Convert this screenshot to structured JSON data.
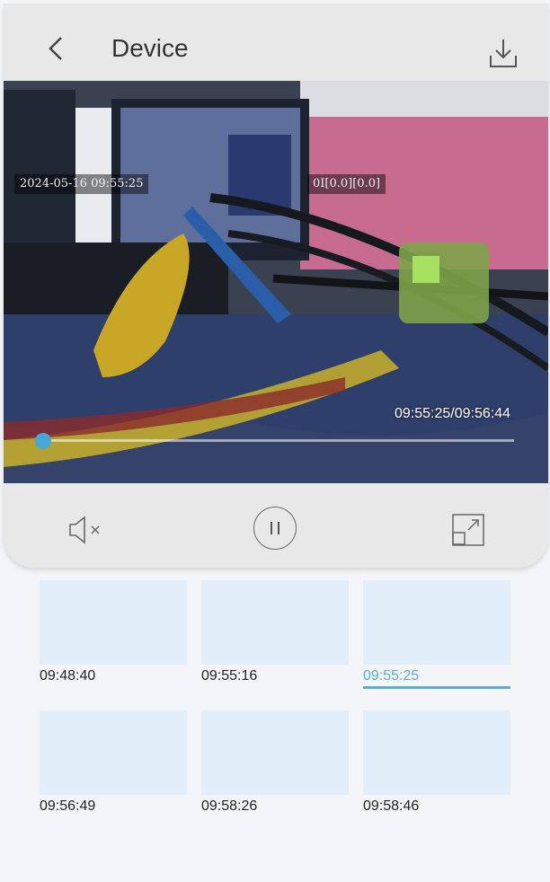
{
  "header": {
    "title": "Device"
  },
  "video": {
    "osd_datetime": "2024-05-16 09:55:25",
    "osd_right": "0I[0.0][0.0]",
    "time_display": "09:55:25/09:56:44",
    "progress": 0.0
  },
  "controls": {
    "mute": "speaker-mute-icon",
    "pause": "pause-icon",
    "fullscreen": "fullscreen-icon"
  },
  "recordings": [
    {
      "time": "09:48:40"
    },
    {
      "time": "09:55:16"
    },
    {
      "time": "09:55:25",
      "selected": true
    },
    {
      "time": "09:56:49"
    },
    {
      "time": "09:58:26"
    },
    {
      "time": "09:58:46"
    }
  ],
  "colors": {
    "accent": "#4aa6d8",
    "selected_text": "#5aaed0",
    "thumb_bg": "#e2eefa"
  }
}
